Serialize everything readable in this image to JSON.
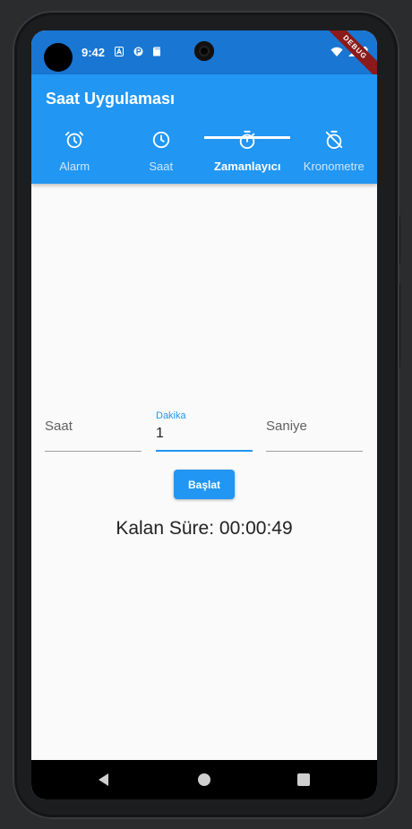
{
  "status_bar": {
    "time": "9:42",
    "icons": [
      "a-icon",
      "p-icon",
      "sd-card-icon"
    ],
    "right_icons": [
      "wifi-icon",
      "signal-icon",
      "battery-icon"
    ],
    "debug_banner": "DEBUG"
  },
  "app": {
    "title": "Saat Uygulaması",
    "accent_color": "#2196f3",
    "tabs": [
      {
        "label": "Alarm",
        "icon": "alarm-icon",
        "active": false
      },
      {
        "label": "Saat",
        "icon": "clock-icon",
        "active": false
      },
      {
        "label": "Zamanlayıcı",
        "icon": "timer-icon",
        "active": true
      },
      {
        "label": "Kronometre",
        "icon": "timer-off-icon",
        "active": false
      }
    ]
  },
  "timer": {
    "hours_placeholder": "Saat",
    "minutes_label": "Dakika",
    "minutes_value": "1",
    "seconds_placeholder": "Saniye",
    "start_button": "Başlat",
    "remaining": "Kalan Süre: 00:00:49"
  },
  "nav": {
    "icons": [
      "back-icon",
      "home-icon",
      "recents-icon"
    ]
  }
}
